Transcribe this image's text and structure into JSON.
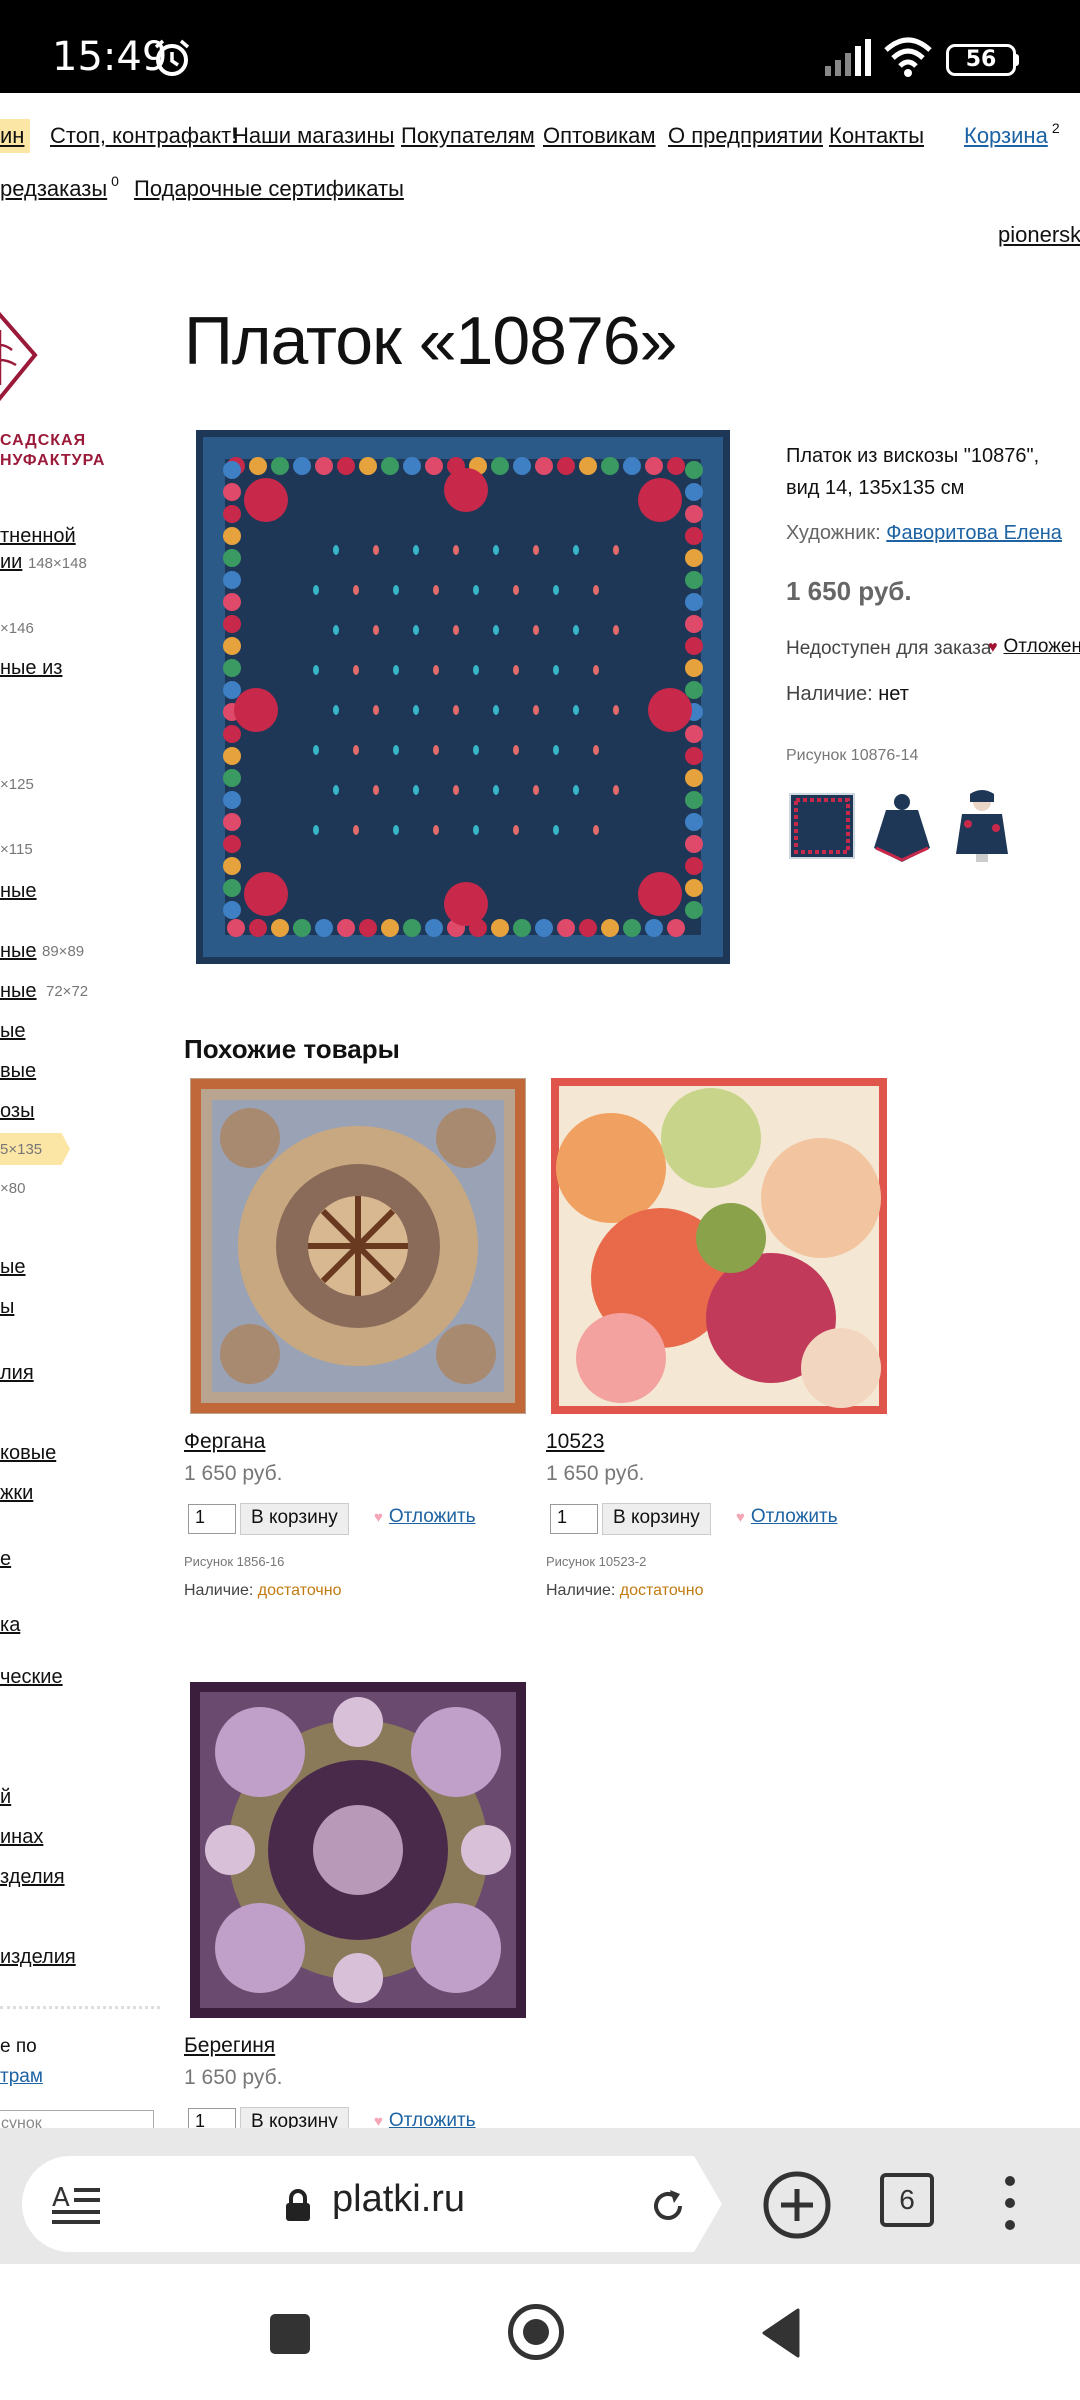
{
  "status_bar": {
    "time": "15:49",
    "battery": "56"
  },
  "nav": {
    "shop_partial": "ин",
    "links": [
      "Стоп, контрафакт!",
      "Наши магазины",
      "Покупателям",
      "Оптовикам",
      "О предприятии",
      "Контакты"
    ],
    "cart_label": "Корзина",
    "cart_count": "2",
    "preorders_label": "редзаказы",
    "preorders_count": "0",
    "gift_certificates": "Подарочные сертификаты",
    "domain_partial": "pionerskr"
  },
  "logo": {
    "line1": "САДСКАЯ",
    "line2": "НУФАКТУРА"
  },
  "sidebar": [
    {
      "label": "тненной"
    },
    {
      "label": "ии",
      "size": "148×148"
    },
    {
      "size": "×146"
    },
    {
      "label": "ные из"
    },
    {
      "size": "×125"
    },
    {
      "size": "×115"
    },
    {
      "label": "ные"
    },
    {
      "label": "ные",
      "size": "89×89"
    },
    {
      "label": "ные",
      "size": "72×72"
    },
    {
      "label": "ые"
    },
    {
      "label": "вые"
    },
    {
      "label": "озы"
    },
    {
      "size": "5×135"
    },
    {
      "size": "×80"
    },
    {
      "label": "ые"
    },
    {
      "label": "ы"
    },
    {
      "label": "лия"
    },
    {
      "label": "ковые"
    },
    {
      "label": "жки"
    },
    {
      "label": "е"
    },
    {
      "label": "ка"
    },
    {
      "label": "ческие"
    },
    {
      "label": "й"
    },
    {
      "label": "инах"
    },
    {
      "label": "зделия"
    },
    {
      "label": "изделия"
    }
  ],
  "sidebar_bottom": {
    "line1": "е по",
    "line2": "трам",
    "search_placeholder": "сунок"
  },
  "product": {
    "title": "Платок «10876»",
    "description": "Платок из вискозы \"10876\", вид 14, 135х135 см",
    "artist_label": "Художник:",
    "artist_name": "Фаворитова Елена",
    "price": "1 650 руб.",
    "unavailable": "Недоступен для заказа",
    "defer": "Отложен",
    "stock_label": "Наличие:",
    "stock_value": "нет",
    "pattern": "Рисунок 10876-14",
    "colors": {
      "fabric": "#1e3756",
      "accent_rose": "#c8284a"
    }
  },
  "similar": {
    "title": "Похожие товары",
    "items": [
      {
        "name": "Фергана",
        "price": "1 650 руб.",
        "qty": "1",
        "cart": "В корзину",
        "defer": "Отложить",
        "pattern": "Рисунок 1856-16",
        "stock_label": "Наличие:",
        "stock_value": "достаточно"
      },
      {
        "name": "10523",
        "price": "1 650 руб.",
        "qty": "1",
        "cart": "В корзину",
        "defer": "Отложить",
        "pattern": "Рисунок 10523-2",
        "stock_label": "Наличие:",
        "stock_value": "достаточно"
      },
      {
        "name": "Берегиня",
        "price": "1 650 руб.",
        "qty": "1",
        "cart": "В корзину",
        "defer": "Отложить"
      }
    ]
  },
  "browser": {
    "url": "platki.ru",
    "tab_count": "6"
  }
}
